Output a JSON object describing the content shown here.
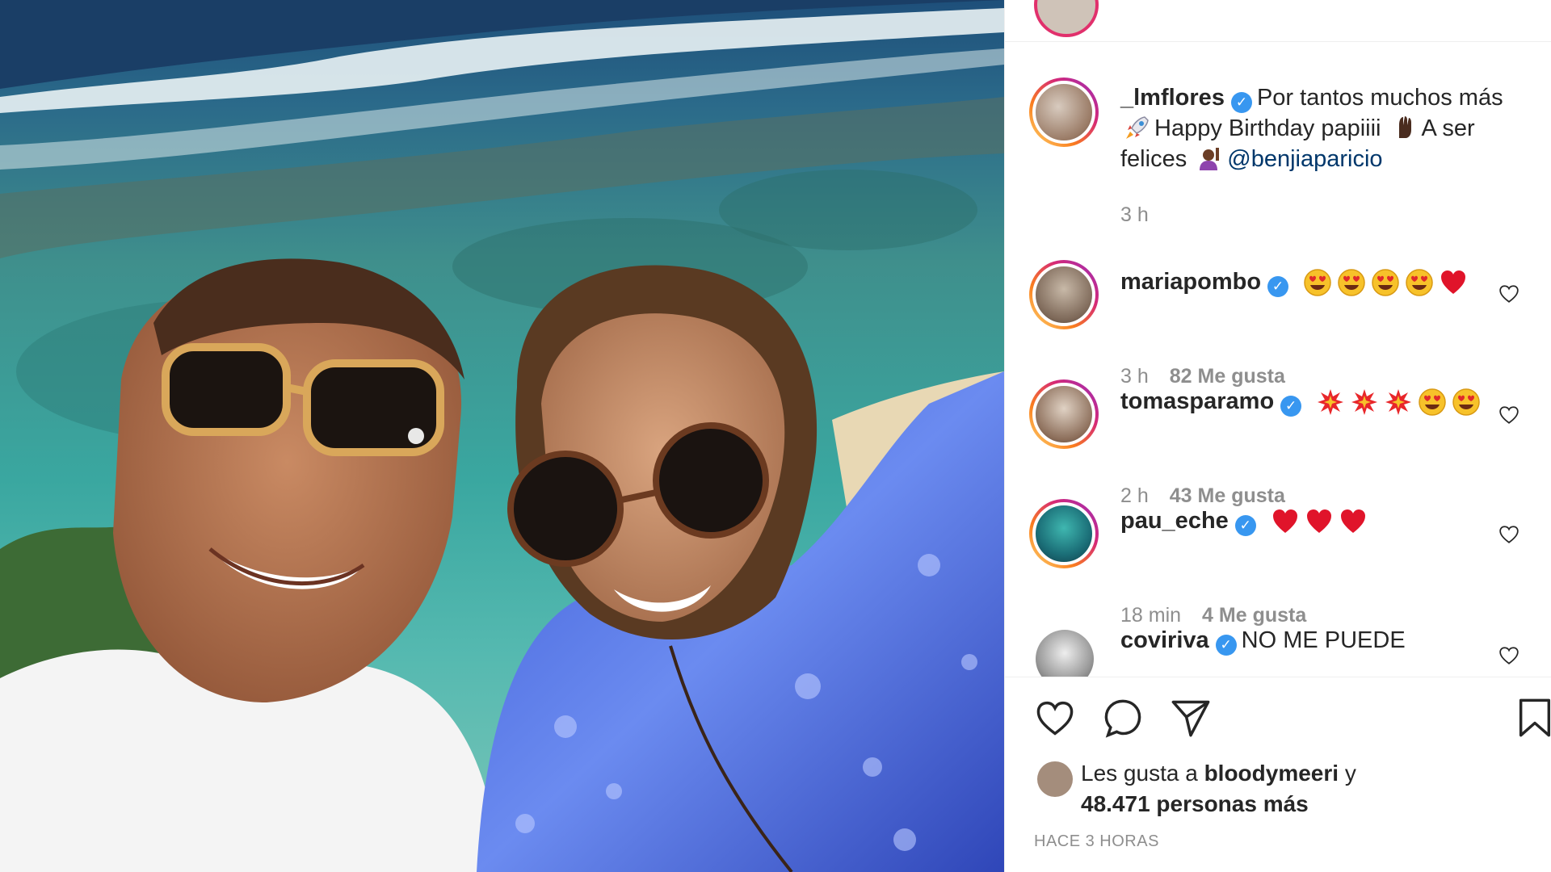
{
  "caption": {
    "username": "_lmflores",
    "text_1": "Por tantos muchos más",
    "text_2": "Happy Birthday papiiii",
    "text_3": "A ser",
    "text_4": "felices",
    "mention": "@benjiaparicio",
    "time": "3 h",
    "emojis": [
      "rocket-emoji",
      "raised-fist-emoji",
      "person-raising-hand-emoji"
    ]
  },
  "comments": [
    {
      "username": "mariapombo",
      "emojis": [
        "heart-eyes",
        "heart-eyes",
        "heart-eyes",
        "heart-eyes",
        "red-heart"
      ],
      "time": "3 h",
      "likes": "82 Me gusta"
    },
    {
      "username": "tomasparamo",
      "emojis": [
        "collision",
        "collision",
        "collision",
        "heart-eyes",
        "heart-eyes"
      ],
      "time": "2 h",
      "likes": "43 Me gusta"
    },
    {
      "username": "pau_eche",
      "emojis": [
        "red-heart",
        "red-heart",
        "red-heart"
      ],
      "time": "18 min",
      "likes": "4 Me gusta"
    },
    {
      "username": "coviriva",
      "text": "NO ME PUEDE"
    }
  ],
  "liked_by": {
    "prefix": "Les gusta a",
    "user": "bloodymeeri",
    "conj": "y",
    "others": "48.471 personas más"
  },
  "time_ago": "HACE 3 HORAS",
  "colors": {
    "verified": "#3897f0",
    "story_ring": "#d62976",
    "meta_gray": "#8e8e8e",
    "mention": "#00376b"
  }
}
